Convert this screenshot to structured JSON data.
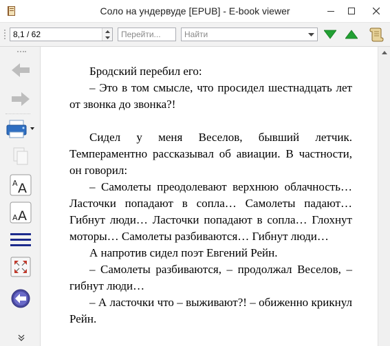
{
  "window": {
    "title": "Соло на ундервуде [EPUB] - E-book viewer"
  },
  "toolbar": {
    "page_value": "8,1 / 62",
    "goto_placeholder": "Перейти...",
    "search_placeholder": "Найти"
  },
  "colors": {
    "find_arrow": "#22a033",
    "nav_arrow": "#bdbdbd",
    "lines_icon": "#1c2a8c",
    "back_circle": "#4a4aa0"
  },
  "content": {
    "paragraphs": [
      "Бродский перебил его:",
      "– Это в том смысле, что просидел шестнадцать лет от звонка до звонка?!",
      "",
      "Сидел у меня Веселов, бывший летчик. Темпераментно рассказывал об авиации. В частности, он говорил:",
      "– Самолеты преодолевают верхнюю облачность… Ласточки попадают в сопла… Самолеты падают… Гибнут люди… Ласточки попадают в сопла… Глохнут моторы… Самолеты разбиваются… Гибнут люди…",
      "А напротив сидел поэт Евгений Рейн.",
      "– Самолеты разбиваются, – продолжал Веселов, – гибнут люди…",
      "– А ласточки что – выживают?! – обиженно крикнул Рейн."
    ]
  }
}
